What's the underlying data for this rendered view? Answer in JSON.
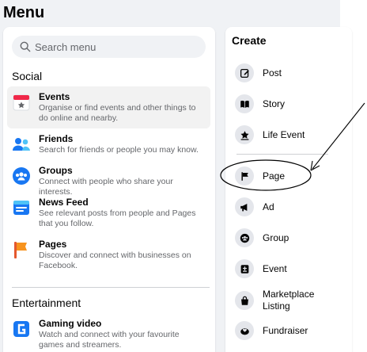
{
  "page": {
    "title": "Menu"
  },
  "search": {
    "placeholder": "Search menu"
  },
  "sections": {
    "social": "Social",
    "entertainment": "Entertainment"
  },
  "social_items": [
    {
      "name": "Events",
      "desc": "Organise or find events and other things to do online and nearby.",
      "icon": "events-icon"
    },
    {
      "name": "Friends",
      "desc": "Search for friends or people you may know.",
      "icon": "friends-icon"
    },
    {
      "name": "Groups",
      "desc": "Connect with people who share your interests.",
      "icon": "groups-icon"
    },
    {
      "name": "News Feed",
      "desc": "See relevant posts from people and Pages that you follow.",
      "icon": "news-feed-icon"
    },
    {
      "name": "Pages",
      "desc": "Discover and connect with businesses on Facebook.",
      "icon": "pages-flag-icon"
    }
  ],
  "entertainment_items": [
    {
      "name": "Gaming video",
      "desc": "Watch and connect with your favourite games and streamers.",
      "icon": "gaming-video-icon"
    }
  ],
  "create": {
    "title": "Create",
    "items": [
      {
        "label": "Post",
        "icon": "compose-icon"
      },
      {
        "label": "Story",
        "icon": "book-icon"
      },
      {
        "label": "Life Event",
        "icon": "star-icon"
      },
      {
        "label": "Page",
        "icon": "flag-icon"
      },
      {
        "label": "Ad",
        "icon": "megaphone-icon"
      },
      {
        "label": "Group",
        "icon": "group-icon"
      },
      {
        "label": "Event",
        "icon": "calendar-icon"
      },
      {
        "label": "Marketplace Listing",
        "icon": "shopping-bag-icon"
      },
      {
        "label": "Fundraiser",
        "icon": "heart-hand-icon"
      }
    ]
  },
  "colors": {
    "accent": "#1877f2",
    "background": "#f0f2f5",
    "secondary_text": "#65676b"
  }
}
